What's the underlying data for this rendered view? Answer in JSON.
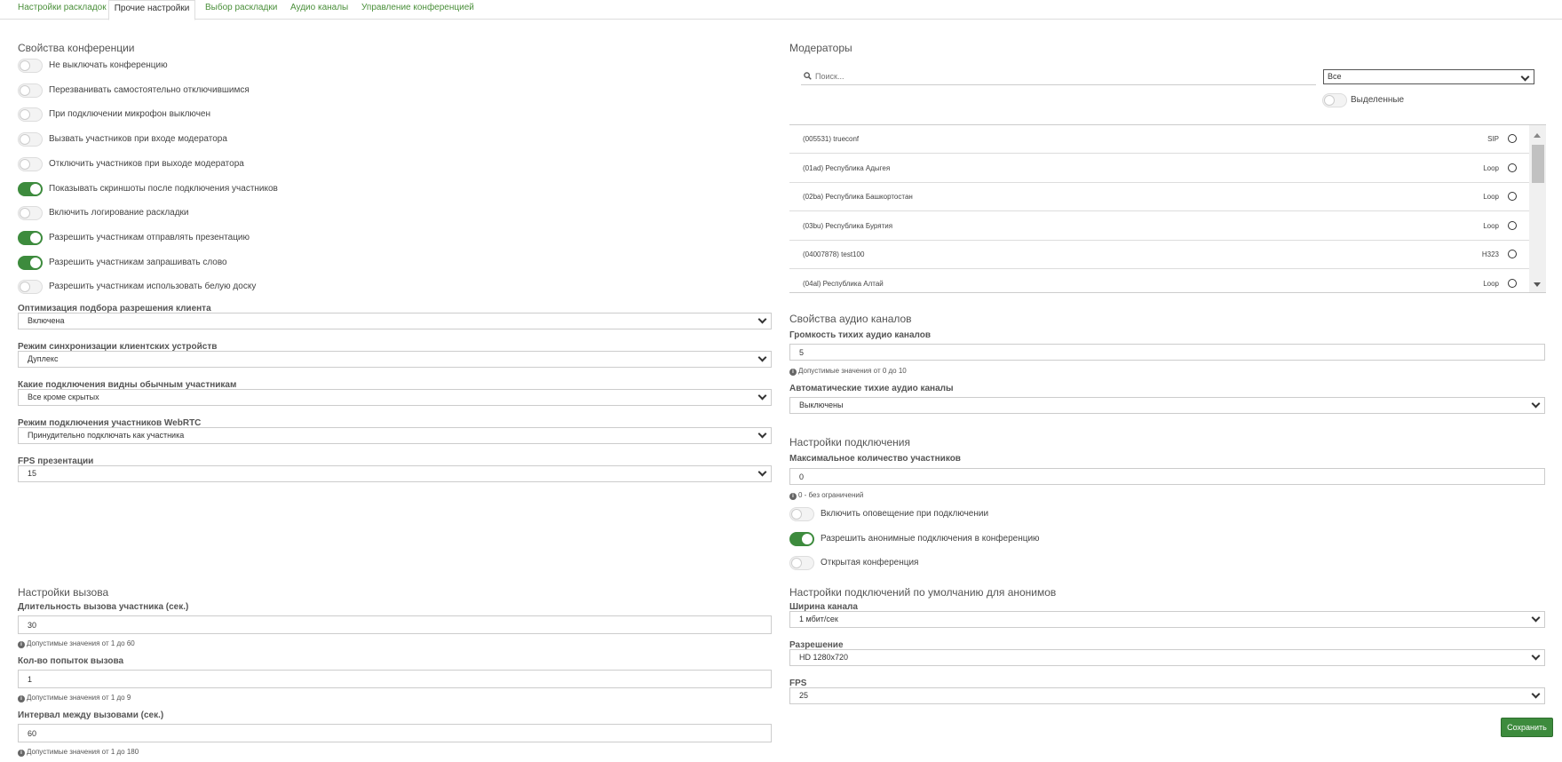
{
  "tabs": [
    {
      "label": "Настройки раскладок"
    },
    {
      "label": "Прочие настройки"
    },
    {
      "label": "Выбор раскладки"
    },
    {
      "label": "Аудио каналы"
    },
    {
      "label": "Управление конференцией"
    }
  ],
  "conference": {
    "title": "Свойства конференции",
    "toggles": [
      {
        "label": "Не выключать конференцию",
        "on": false
      },
      {
        "label": "Перезванивать самостоятельно отключившимся",
        "on": false
      },
      {
        "label": "При подключении микрофон выключен",
        "on": false
      },
      {
        "label": "Вызвать участников при входе модератора",
        "on": false
      },
      {
        "label": "Отключить участников при выходе модератора",
        "on": false
      },
      {
        "label": "Показывать скриншоты после подключения участников",
        "on": true
      },
      {
        "label": "Включить логирование раскладки",
        "on": false
      },
      {
        "label": "Разрешить участникам отправлять презентацию",
        "on": true
      },
      {
        "label": "Разрешить участникам запрашивать слово",
        "on": true
      },
      {
        "label": "Разрешить участникам использовать белую доску",
        "on": false
      }
    ],
    "selects": [
      {
        "label": "Оптимизация подбора разрешения клиента",
        "value": "Включена"
      },
      {
        "label": "Режим синхронизации клиентских устройств",
        "value": "Дуплекс"
      },
      {
        "label": "Какие подключения видны обычным участникам",
        "value": "Все кроме скрытых"
      },
      {
        "label": "Режим подключения участников WebRTC",
        "value": "Принудительно подключать как участника"
      },
      {
        "label": "FPS презентации",
        "value": "15"
      }
    ]
  },
  "call": {
    "title": "Настройки вызова",
    "fields": [
      {
        "label": "Длительность вызова участника (сек.)",
        "value": "30",
        "hint": "Допустимые значения от 1 до 60"
      },
      {
        "label": "Кол-во попыток вызова",
        "value": "1",
        "hint": "Допустимые значения от 1 до 9"
      },
      {
        "label": "Интервал между вызовами (сек.)",
        "value": "60",
        "hint": "Допустимые значения от 1 до 180"
      }
    ]
  },
  "moderators": {
    "title": "Модераторы",
    "search_placeholder": "Поиск...",
    "filter_value": "Все",
    "selected_label": "Выделенные",
    "selected_on": false,
    "items": [
      {
        "name": "(005531) trueconf",
        "type": "SIP"
      },
      {
        "name": "(01ad) Республика Адыгея",
        "type": "Loop"
      },
      {
        "name": "(02ba) Республика Башкортостан",
        "type": "Loop"
      },
      {
        "name": "(03bu) Республика Бурятия",
        "type": "Loop"
      },
      {
        "name": "(04007878) test100",
        "type": "H323"
      },
      {
        "name": "(04al) Республика Алтай",
        "type": "Loop"
      }
    ]
  },
  "audio": {
    "title": "Свойства аудио каналов",
    "volume_label": "Громкость тихих аудио каналов",
    "volume_value": "5",
    "volume_hint": "Допустимые значения от 0 до 10",
    "auto_label": "Автоматические тихие аудио каналы",
    "auto_value": "Выключены"
  },
  "connection": {
    "title": "Настройки подключения",
    "max_label": "Максимальное количество участников",
    "max_value": "0",
    "max_hint": "0 - без ограничений",
    "toggles": [
      {
        "label": "Включить оповещение при подключении",
        "on": false
      },
      {
        "label": "Разрешить анонимные подключения в конференцию",
        "on": true
      },
      {
        "label": "Открытая конференция",
        "on": false
      }
    ]
  },
  "anon": {
    "title": "Настройки подключений по умолчанию для анонимов",
    "selects": [
      {
        "label": "Ширина канала",
        "value": "1 мбит/сек"
      },
      {
        "label": "Разрешение",
        "value": "HD 1280x720"
      },
      {
        "label": "FPS",
        "value": "25"
      }
    ]
  },
  "save_label": "Сохранить"
}
